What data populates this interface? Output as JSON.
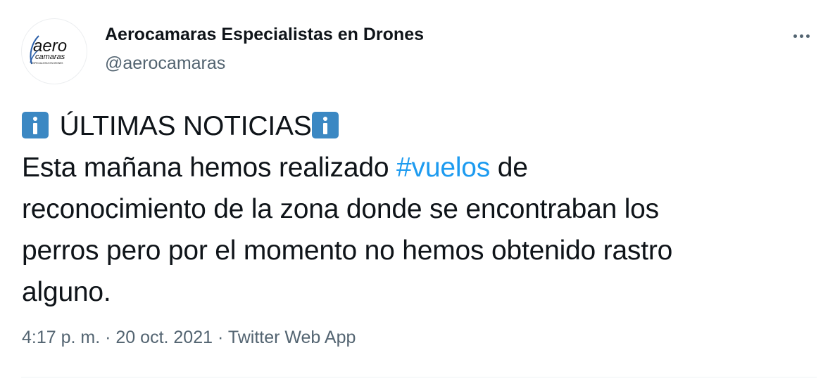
{
  "author": {
    "display_name": "Aerocamaras Especialistas en Drones",
    "handle": "@aerocamaras",
    "avatar": {
      "icon": "aerocamaras-logo",
      "logo_text_top": "aero",
      "logo_text_bottom": "camaras",
      "logo_tagline": "ESPECIALISTAS EN DRONES"
    }
  },
  "menu": {
    "icon": "more-horizontal-icon"
  },
  "tweet": {
    "headline_icon": "information-emoji",
    "headline": "ÚLTIMAS NOTICIAS",
    "line1_before": "Esta mañana hemos realizado ",
    "hashtag": "#vuelos",
    "line1_after": " de",
    "line2": "reconocimiento de la zona donde se encontraban los",
    "line3": "perros pero por el momento no hemos obtenido rastro",
    "line4": "alguno."
  },
  "meta": {
    "time": "4:17 p. m.",
    "separator": "·",
    "date": "20 oct. 2021",
    "source": "Twitter Web App"
  },
  "colors": {
    "text": "#0f1419",
    "secondary": "#536471",
    "link": "#1d9bf0",
    "emoji_blue": "#3b88c3",
    "logo_blue": "#2b5fa8"
  }
}
